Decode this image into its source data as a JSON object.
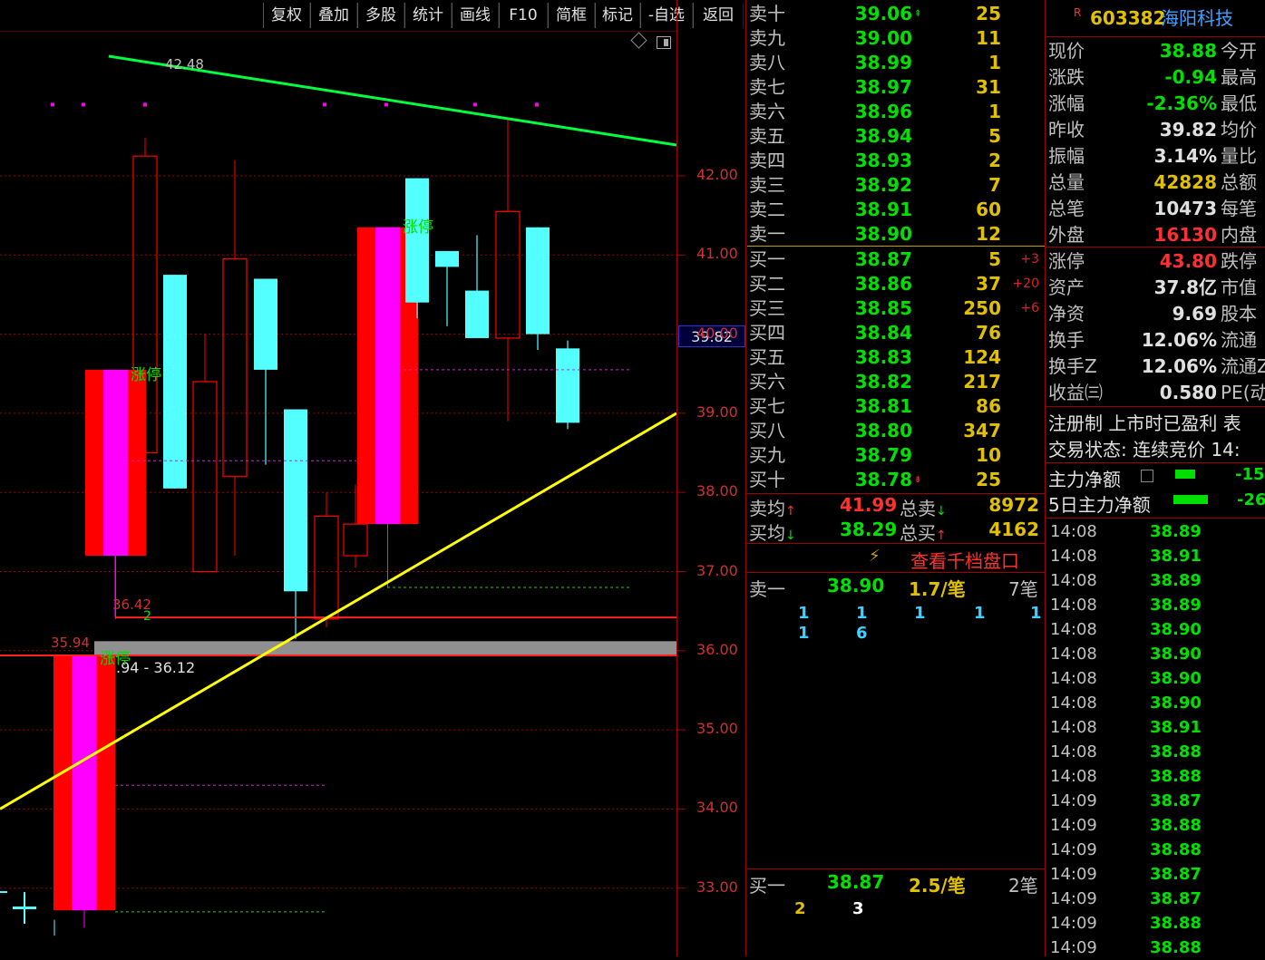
{
  "toolbar": {
    "items": [
      "复权",
      "叠加",
      "多股",
      "统计",
      "画线",
      "F10",
      "简框",
      "标记",
      "-自选",
      "返回"
    ]
  },
  "chart": {
    "price_axis": [
      "42.00",
      "41.00",
      "40.00",
      "39.00",
      "38.00",
      "37.00",
      "36.00",
      "35.00",
      "34.00",
      "33.00"
    ],
    "prev_close_tag": "39.82",
    "annotations": {
      "high_label": "42.48",
      "low_label": "36.42",
      "low_count": "2",
      "gap_low": "35.94",
      "gap_range": ".94 - 36.12",
      "limit_up_1": "涨停",
      "limit_up_2": "涨停",
      "limit_up_3": "涨停"
    },
    "colors": {
      "up": "#ff0000",
      "down": "#54ffff",
      "limit_up": "#ff00ff",
      "trend_top": "#00ff40",
      "trend_bottom": "#ffff00"
    }
  },
  "orderbook": {
    "asks": [
      {
        "label": "卖十",
        "price": "39.06",
        "vol": "25",
        "mark": "up"
      },
      {
        "label": "卖九",
        "price": "39.00",
        "vol": "11"
      },
      {
        "label": "卖八",
        "price": "38.99",
        "vol": "1"
      },
      {
        "label": "卖七",
        "price": "38.97",
        "vol": "31"
      },
      {
        "label": "卖六",
        "price": "38.96",
        "vol": "1"
      },
      {
        "label": "卖五",
        "price": "38.94",
        "vol": "5"
      },
      {
        "label": "卖四",
        "price": "38.93",
        "vol": "2"
      },
      {
        "label": "卖三",
        "price": "38.92",
        "vol": "7"
      },
      {
        "label": "卖二",
        "price": "38.91",
        "vol": "60"
      },
      {
        "label": "卖一",
        "price": "38.90",
        "vol": "12"
      }
    ],
    "bids": [
      {
        "label": "买一",
        "price": "38.87",
        "vol": "5",
        "chg": "+3"
      },
      {
        "label": "买二",
        "price": "38.86",
        "vol": "37",
        "chg": "+20"
      },
      {
        "label": "买三",
        "price": "38.85",
        "vol": "250",
        "chg": "+6"
      },
      {
        "label": "买四",
        "price": "38.84",
        "vol": "76"
      },
      {
        "label": "买五",
        "price": "38.83",
        "vol": "124"
      },
      {
        "label": "买六",
        "price": "38.82",
        "vol": "217"
      },
      {
        "label": "买七",
        "price": "38.81",
        "vol": "86"
      },
      {
        "label": "买八",
        "price": "38.80",
        "vol": "347"
      },
      {
        "label": "买九",
        "price": "38.79",
        "vol": "10"
      },
      {
        "label": "买十",
        "price": "38.78",
        "vol": "25",
        "mark": "down"
      }
    ],
    "avg_sell_label": "卖均",
    "avg_sell": "41.99",
    "total_sell_label": "总卖",
    "total_sell": "8972",
    "avg_buy_label": "买均",
    "avg_buy": "38.29",
    "total_buy_label": "总买",
    "total_buy": "4162",
    "depth_link": "查看千档盘口",
    "queue_sell": {
      "label": "卖一",
      "price": "38.90",
      "per": "1.7/笔",
      "count": "7笔",
      "orders": [
        "1",
        "1",
        "1",
        "1",
        "1",
        "1",
        "6"
      ]
    },
    "queue_buy": {
      "label": "买一",
      "price": "38.87",
      "per": "2.5/笔",
      "count": "2笔",
      "orders": [
        "2",
        "3"
      ]
    }
  },
  "stock": {
    "badge": "R",
    "code": "603382",
    "name": "海阳科技"
  },
  "quote": [
    {
      "k": "现价",
      "v": "38.88",
      "c": "#00e000",
      "k2": "今开"
    },
    {
      "k": "涨跌",
      "v": "-0.94",
      "c": "#00e000",
      "k2": "最高"
    },
    {
      "k": "涨幅",
      "v": "-2.36%",
      "c": "#00e000",
      "k2": "最低"
    },
    {
      "k": "昨收",
      "v": "39.82",
      "c": "#e0e0e0",
      "k2": "均价"
    },
    {
      "k": "振幅",
      "v": "3.14%",
      "c": "#e0e0e0",
      "k2": "量比"
    },
    {
      "k": "总量",
      "v": "42828",
      "c": "#e0c000",
      "k2": "总额"
    },
    {
      "k": "总笔",
      "v": "10473",
      "c": "#e0e0e0",
      "k2": "每笔"
    },
    {
      "k": "外盘",
      "v": "16130",
      "c": "#ff3030",
      "k2": "内盘"
    }
  ],
  "fundamentals": [
    {
      "k": "涨停",
      "v": "43.80",
      "c": "#ff3030",
      "k2": "跌停"
    },
    {
      "k": "资产",
      "v": "37.8亿",
      "c": "#e0e0e0",
      "k2": "市值"
    },
    {
      "k": "净资",
      "v": "9.69",
      "c": "#e0e0e0",
      "k2": "股本"
    },
    {
      "k": "换手",
      "v": "12.06%",
      "c": "#e0e0e0",
      "k2": "流通"
    },
    {
      "k": "换手Z",
      "v": "12.06%",
      "c": "#e0e0e0",
      "k2": "流通Z"
    },
    {
      "k": "收益㈢",
      "v": "0.580",
      "c": "#e0e0e0",
      "k2": "PE(动)"
    }
  ],
  "status": {
    "line1": "注册制 上市时已盈利 表",
    "line2": "交易状态: 连续竞价 14:",
    "main_net_label": "主力净额",
    "main_net_value": "-15",
    "main_net5_label": "5日主力净额",
    "main_net5_value": "-26"
  },
  "ticks": [
    {
      "t": "14:08",
      "p": "38.89"
    },
    {
      "t": "14:08",
      "p": "38.91"
    },
    {
      "t": "14:08",
      "p": "38.89"
    },
    {
      "t": "14:08",
      "p": "38.89"
    },
    {
      "t": "14:08",
      "p": "38.90"
    },
    {
      "t": "14:08",
      "p": "38.90"
    },
    {
      "t": "14:08",
      "p": "38.90"
    },
    {
      "t": "14:08",
      "p": "38.90"
    },
    {
      "t": "14:08",
      "p": "38.91"
    },
    {
      "t": "14:08",
      "p": "38.88"
    },
    {
      "t": "14:08",
      "p": "38.88"
    },
    {
      "t": "14:09",
      "p": "38.87"
    },
    {
      "t": "14:09",
      "p": "38.88"
    },
    {
      "t": "14:09",
      "p": "38.88"
    },
    {
      "t": "14:09",
      "p": "38.87"
    },
    {
      "t": "14:09",
      "p": "38.87"
    },
    {
      "t": "14:09",
      "p": "38.88"
    },
    {
      "t": "14:09",
      "p": "38.88"
    }
  ]
}
